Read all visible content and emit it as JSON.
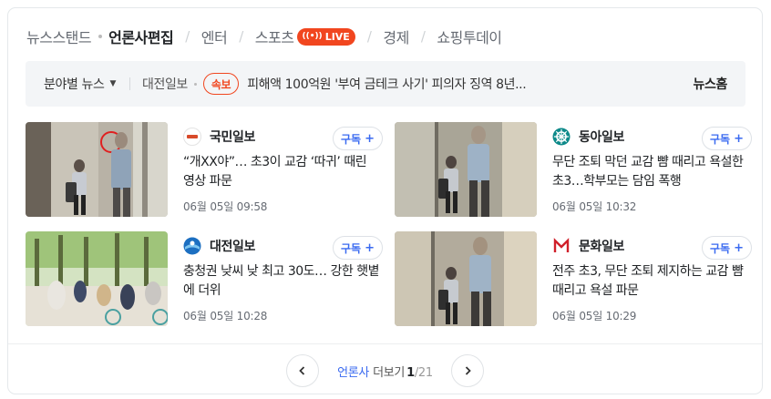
{
  "tabs": [
    {
      "label": "뉴스스탠드"
    },
    {
      "label": "언론사편집"
    },
    {
      "label": "엔터"
    },
    {
      "label": "스포츠"
    },
    {
      "label": "경제"
    },
    {
      "label": "쇼핑투데이"
    }
  ],
  "live_badge": "LIVE",
  "ticker": {
    "category": "분야별 뉴스",
    "press": "대전일보",
    "breaking": "속보",
    "headline": "피해액 100억원 '부여 금테크 사기' 피의자 징역 8년...",
    "news_home": "뉴스홈"
  },
  "subscribe_label": "구독",
  "articles": [
    {
      "press": "국민일보",
      "title": "“개XX야”… 초3이 교감 ‘따귀’ 때린 영상 파문",
      "date": "06월 05일 09:58"
    },
    {
      "press": "동아일보",
      "title": "무단 조퇴 막던 교감 뺨 때리고 욕설한 초3…학부모는 담임 폭행",
      "date": "06월 05일 10:32"
    },
    {
      "press": "대전일보",
      "title": "충청권 낮씨 낮 최고 30도… 강한 햇볕에 더위",
      "date": "06월 05일 10:28"
    },
    {
      "press": "문화일보",
      "title": "전주 초3, 무단 조퇴 제지하는 교감 뺨 때리고 욕설 파문",
      "date": "06월 05일 10:29"
    }
  ],
  "pager": {
    "link": "언론사",
    "text": "더보기",
    "current": "1",
    "separator": "/",
    "total": "21"
  },
  "colors": {
    "accent": "#3a6af0",
    "live": "#f1461f",
    "ticker_bg": "#f3f5f7"
  }
}
